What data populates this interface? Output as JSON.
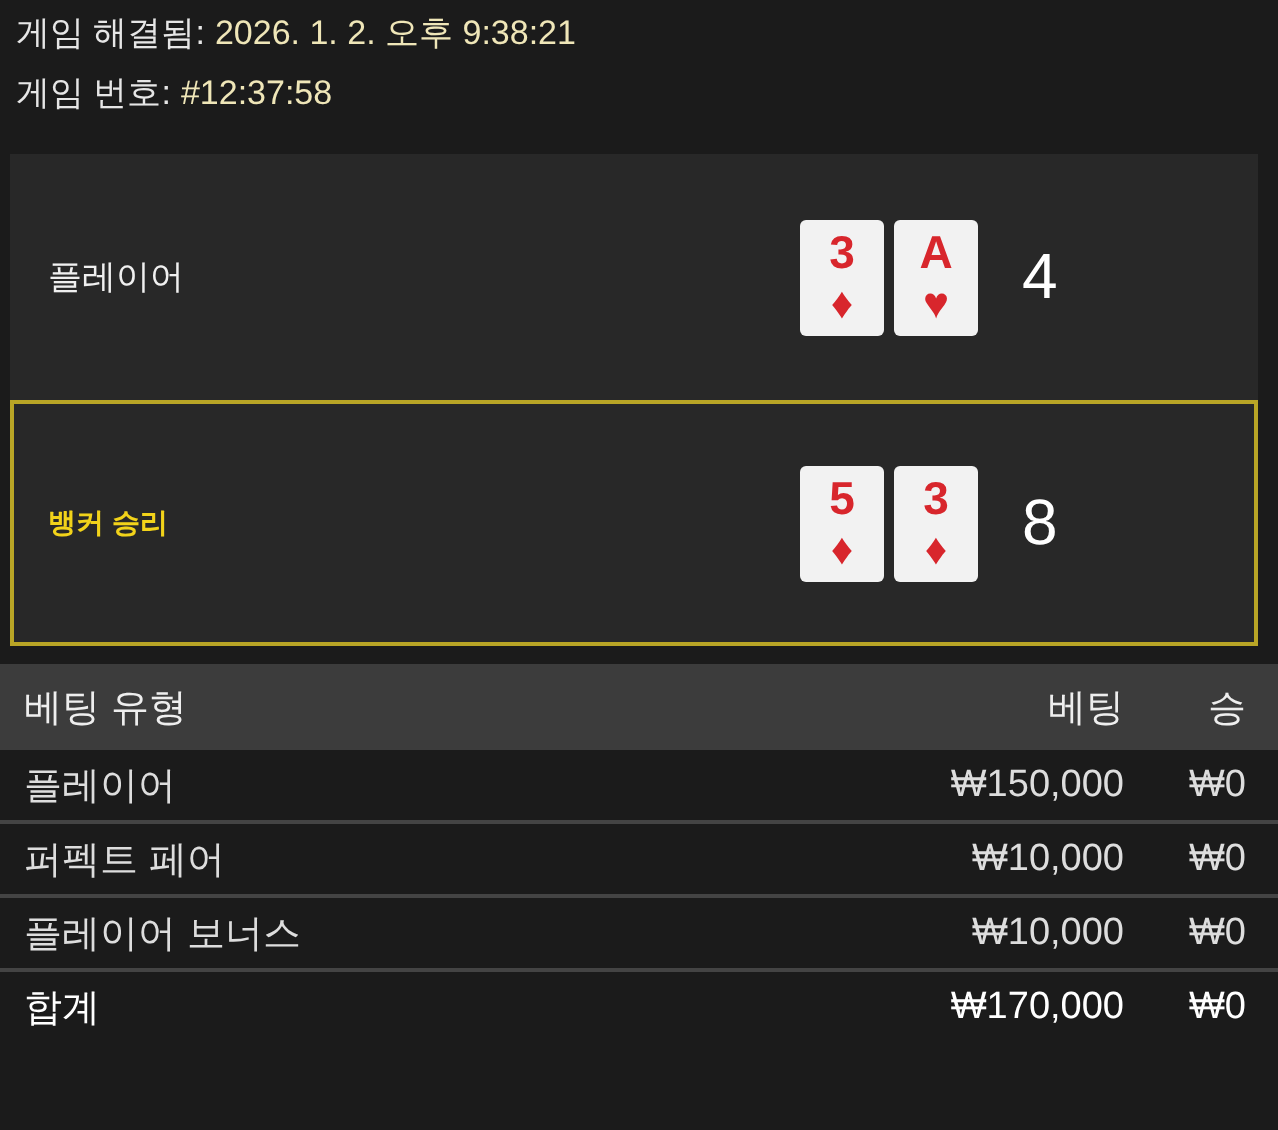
{
  "info": [
    {
      "label": "게임 해결됨:",
      "value": "2026. 1. 2. 오후 9:38:21"
    },
    {
      "label": "게임 번호:",
      "value": "#12:37:58"
    }
  ],
  "hands": [
    {
      "name": "플레이어",
      "winner": false,
      "cards": [
        {
          "rank": "3",
          "suit": "♦"
        },
        {
          "rank": "A",
          "suit": "♥"
        }
      ],
      "score": "4"
    },
    {
      "name": "뱅커 승리",
      "winner": true,
      "cards": [
        {
          "rank": "5",
          "suit": "♦"
        },
        {
          "rank": "3",
          "suit": "♦"
        }
      ],
      "score": "8"
    }
  ],
  "table": {
    "columns": [
      "베팅 유형",
      "베팅",
      "승"
    ],
    "rows": [
      {
        "kind": "bet",
        "cells": [
          "플레이어",
          "₩150,000",
          "₩0"
        ]
      },
      {
        "kind": "bet",
        "cells": [
          "퍼펙트 페어",
          "₩10,000",
          "₩0"
        ]
      },
      {
        "kind": "bet",
        "cells": [
          "플레이어 보너스",
          "₩10,000",
          "₩0"
        ]
      },
      {
        "kind": "total",
        "cells": [
          "합계",
          "₩170,000",
          "₩0"
        ]
      }
    ]
  }
}
